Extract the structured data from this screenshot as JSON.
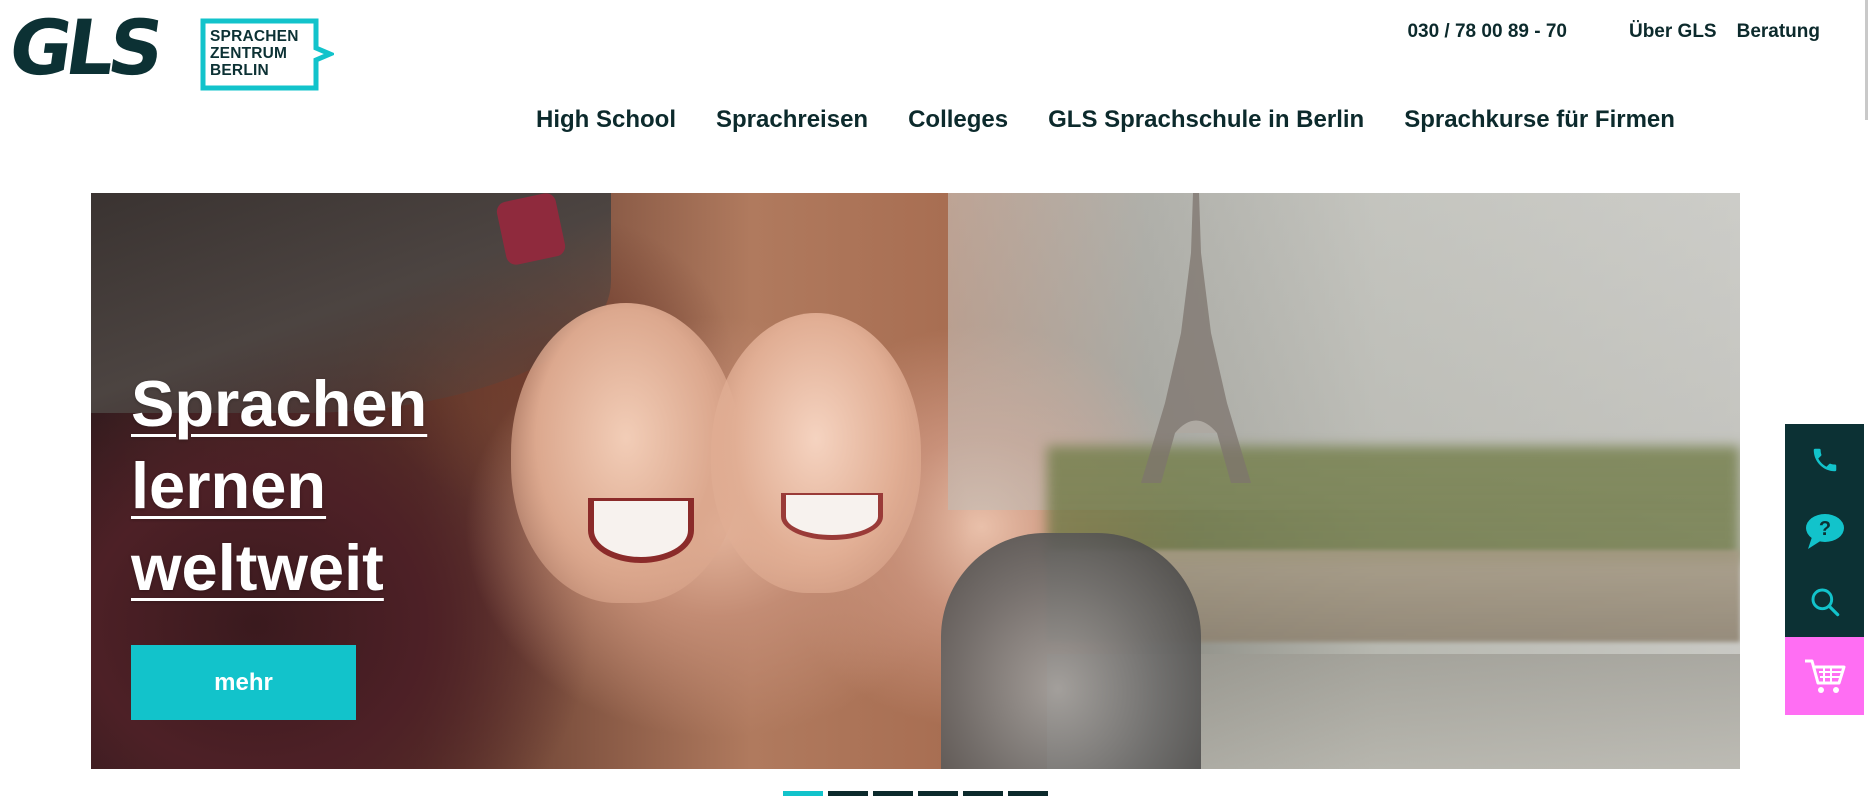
{
  "logo": {
    "wordmark": "GLS",
    "tag_lines": [
      "SPRACHEN",
      "ZENTRUM",
      "BERLIN"
    ]
  },
  "topbar": {
    "phone": "030 / 78 00 89 - 70",
    "links": [
      "Über GLS",
      "Beratung"
    ]
  },
  "mainnav": {
    "items": [
      "High School",
      "Sprachreisen",
      "Colleges",
      "GLS Sprachschule in Berlin",
      "Sprachkurse für Firmen"
    ]
  },
  "hero": {
    "title_lines": [
      "Sprachen",
      "lernen",
      "weltweit"
    ],
    "button_label": "mehr"
  },
  "carousel": {
    "total_slides": 6,
    "active_index": 0
  },
  "sidebar": {
    "icons": [
      "phone-icon",
      "question-chat-icon",
      "search-icon",
      "cart-icon"
    ]
  },
  "colors": {
    "brand_dark": "#0c3134",
    "accent_teal": "#12c3cb",
    "cart_pink": "#ff6ef3"
  }
}
